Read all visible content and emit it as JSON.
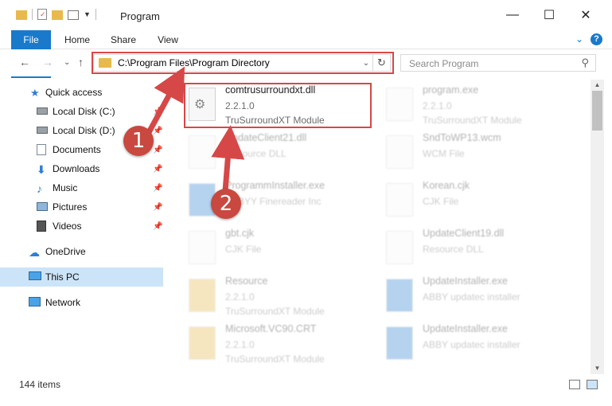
{
  "window": {
    "title": "Program",
    "minimize_glyph": "—",
    "maximize_glyph": "☐",
    "close_glyph": "✕"
  },
  "ribbon": {
    "tabs": [
      "File",
      "Home",
      "Share",
      "View"
    ],
    "help_glyph": "?",
    "expand_glyph": "⌄"
  },
  "navigation": {
    "back_glyph": "←",
    "forward_glyph": "→",
    "recent_glyph": "⌄",
    "up_glyph": "↑",
    "address_path": "C:\\Program Files\\Program Directory",
    "search_placeholder": "Search Program"
  },
  "sidebar": {
    "items": [
      {
        "label": "Quick access",
        "icon": "star-icon"
      },
      {
        "label": "Local Disk (C:)",
        "icon": "drive-icon"
      },
      {
        "label": "Local Disk (D:)",
        "icon": "drive-icon"
      },
      {
        "label": "Documents",
        "icon": "documents-icon"
      },
      {
        "label": "Downloads",
        "icon": "downloads-icon"
      },
      {
        "label": "Music",
        "icon": "music-icon"
      },
      {
        "label": "Pictures",
        "icon": "pictures-icon"
      },
      {
        "label": "Videos",
        "icon": "videos-icon"
      },
      {
        "label": "OneDrive",
        "icon": "cloud-icon"
      },
      {
        "label": "This PC",
        "icon": "computer-icon"
      },
      {
        "label": "Network",
        "icon": "network-icon"
      }
    ]
  },
  "files": [
    {
      "name": "comtrusurroundxt.dll",
      "version": "2.2.1.0",
      "desc": "TruSurroundXT Module"
    },
    {
      "name": "program.exe",
      "version": "2.2.1.0",
      "desc": "TruSurroundXT Module"
    },
    {
      "name": "UpdateClient21.dll",
      "version": "",
      "desc": "Resource DLL"
    },
    {
      "name": "SndToWP13.wcm",
      "version": "",
      "desc": "WCM File"
    },
    {
      "name": "ProgrammInstaller.exe",
      "version": "",
      "desc": "ABBYY Finereader Inc"
    },
    {
      "name": "Korean.cjk",
      "version": "",
      "desc": "CJK File"
    },
    {
      "name": "gbt.cjk",
      "version": "",
      "desc": "CJK File"
    },
    {
      "name": "UpdateClient19.dll",
      "version": "",
      "desc": "Resource DLL"
    },
    {
      "name": "Resource",
      "version": "2.2.1.0",
      "desc": "TruSurroundXT Module"
    },
    {
      "name": "UpdateInstaller.exe",
      "version": "",
      "desc": "ABBY updatec installer"
    },
    {
      "name": "Microsoft.VC90.CRT",
      "version": "2.2.1.0",
      "desc": "TruSurroundXT Module"
    },
    {
      "name": "UpdateInstaller.exe",
      "version": "",
      "desc": "ABBY updatec installer"
    }
  ],
  "status": {
    "item_count": "144 items"
  },
  "callouts": [
    "1",
    "2"
  ],
  "colors": {
    "accent": "#1979ca",
    "highlight": "#d64848",
    "callout": "#c9483f",
    "selected": "#cce4f7"
  }
}
